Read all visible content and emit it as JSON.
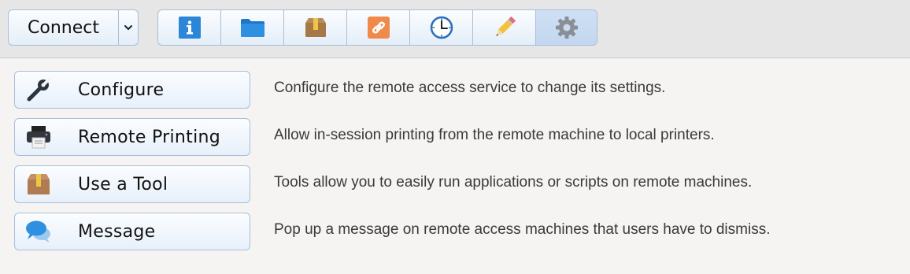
{
  "toolbar": {
    "connect_label": "Connect",
    "tabs": [
      {
        "name": "info-icon",
        "selected": false
      },
      {
        "name": "folder-icon",
        "selected": false
      },
      {
        "name": "package-icon",
        "selected": false
      },
      {
        "name": "link-icon",
        "selected": false
      },
      {
        "name": "clock-icon",
        "selected": false
      },
      {
        "name": "pencil-icon",
        "selected": false
      },
      {
        "name": "gear-icon",
        "selected": true
      }
    ]
  },
  "actions": [
    {
      "label": "Configure",
      "icon": "wrench-icon",
      "description": "Configure the remote access service to change its settings."
    },
    {
      "label": "Remote Printing",
      "icon": "printer-icon",
      "description": "Allow in-session printing from the remote machine to local printers."
    },
    {
      "label": "Use a Tool",
      "icon": "package-icon",
      "description": "Tools allow you to easily run applications or scripts on remote machines."
    },
    {
      "label": "Message",
      "icon": "chat-bubbles-icon",
      "description": "Pop up a message on remote access machines that users have to dismiss."
    }
  ],
  "colors": {
    "button_border": "#a8bfd6",
    "selected_tab": "#c8dbf2",
    "info_blue": "#2b86d8",
    "link_orange": "#f08a4b"
  }
}
